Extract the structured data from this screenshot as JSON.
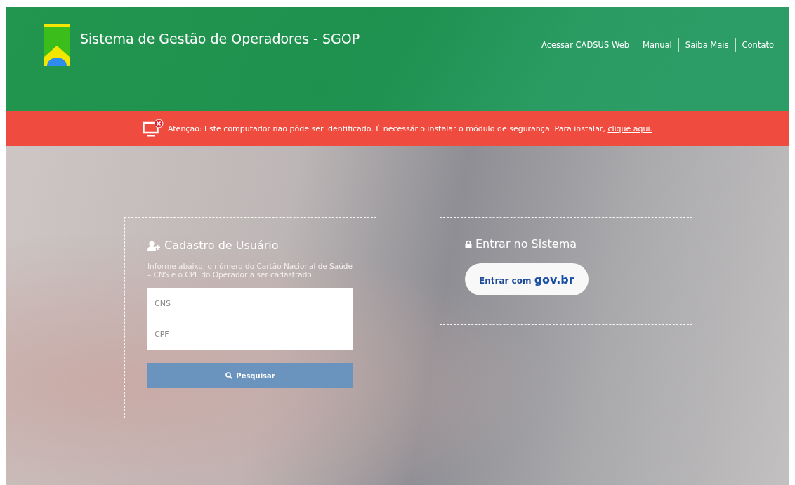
{
  "header": {
    "title": "Sistema de Gestão de Operadores - SGOP",
    "nav": [
      "Acessar CADSUS Web",
      "Manual",
      "Saiba Mais",
      "Contato"
    ]
  },
  "alert": {
    "text": "Atenção: Este computador não pôde ser identificado. É necessário instalar o módulo de segurança. Para instalar,",
    "link": "clique aqui."
  },
  "register": {
    "title": "Cadastro de Usuário",
    "description": "Informe abaixo, o número do Cartão Nacional de Saúde – CNS e o CPF do Operador a ser cadastrado",
    "fields": [
      {
        "placeholder": "CNS"
      },
      {
        "placeholder": "CPF"
      }
    ],
    "button": "Pesquisar"
  },
  "login": {
    "title": "Entrar no Sistema",
    "button": "Entrar com **gov.br**"
  }
}
